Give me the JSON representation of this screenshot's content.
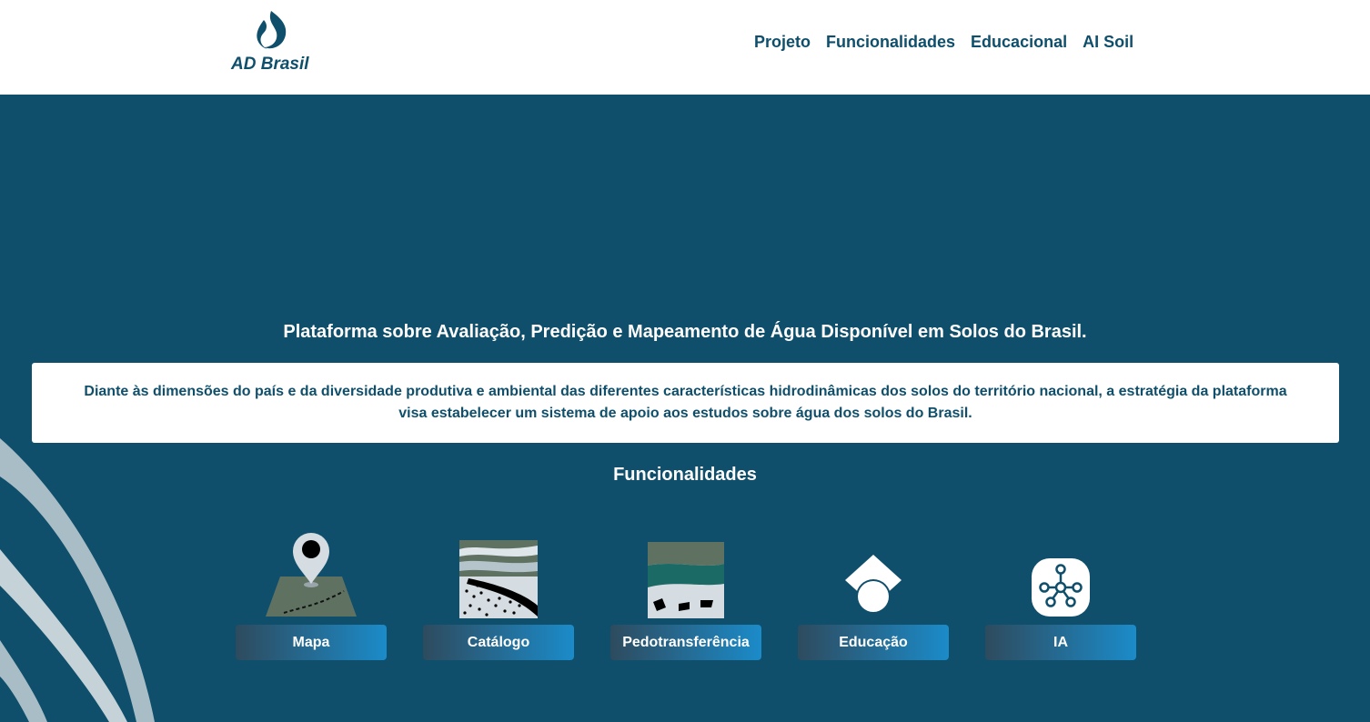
{
  "brand": {
    "name": "AD Brasil",
    "logo_icon": "water-drop-swirl-icon",
    "color": "#0f4f6b"
  },
  "nav": [
    {
      "label": "Projeto"
    },
    {
      "label": "Funcionalidades"
    },
    {
      "label": "Educacional"
    },
    {
      "label": "AI Soil"
    }
  ],
  "hero": {
    "headline": "Plataforma sobre Avaliação, Predição e Mapeamento de Água Disponível em Solos do Brasil.",
    "description": "Diante às dimensões do país e da diversidade produtiva e ambiental das diferentes características hidrodinâmicas dos solos do território nacional, a estratégia da plataforma visa estabelecer um sistema de apoio aos estudos sobre água dos solos do Brasil."
  },
  "features": {
    "title": "Funcionalidades",
    "items": [
      {
        "label": "Mapa",
        "icon": "map-pin-icon"
      },
      {
        "label": "Catálogo",
        "icon": "soil-layers-icon"
      },
      {
        "label": "Pedotransferência",
        "icon": "soil-profile-icon"
      },
      {
        "label": "Educação",
        "icon": "graduation-cap-icon"
      },
      {
        "label": "IA",
        "icon": "neural-network-icon"
      }
    ]
  },
  "colors": {
    "primary": "#0f4f6b",
    "accent": "#1b8bc9",
    "white": "#ffffff"
  }
}
